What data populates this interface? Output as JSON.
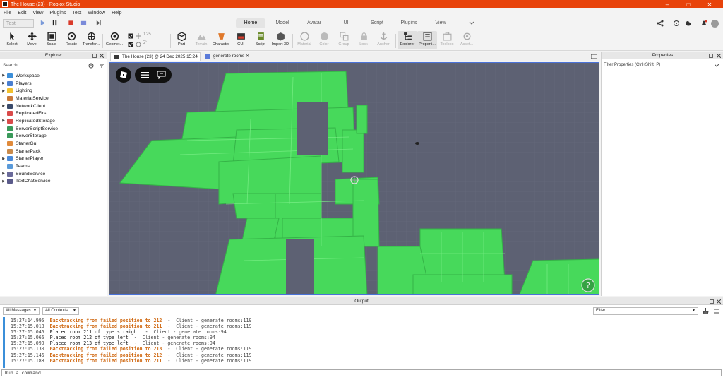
{
  "window": {
    "title": "The House (23) - Roblox Studio"
  },
  "menu": [
    "File",
    "Edit",
    "View",
    "Plugins",
    "Test",
    "Window",
    "Help"
  ],
  "test_selector": "Test",
  "ribbon_tabs": [
    "Home",
    "Model",
    "Avatar",
    "UI",
    "Script",
    "Plugins",
    "View"
  ],
  "active_ribbon_tab": "Home",
  "toolbar": {
    "select": "Select",
    "move": "Move",
    "scale": "Scale",
    "rotate": "Rotate",
    "transform": "Transfor...",
    "geometry": "Geomet...",
    "move_snap": "0.25",
    "rotate_snap": "5°",
    "part": "Part",
    "terrain": "Terrain",
    "character": "Character",
    "gui": "GUI",
    "script": "Script",
    "import3d": "Import 3D",
    "material": "Material",
    "color": "Color",
    "group": "Group",
    "lock": "Lock",
    "anchor": "Anchor",
    "explorer": "Explorer",
    "properties": "Properti...",
    "toolbox": "Toolbox",
    "assets": "Asset..."
  },
  "explorer": {
    "title": "Explorer",
    "search_placeholder": "Search",
    "items": [
      {
        "label": "Workspace",
        "expandable": true,
        "color": "#3d8fd9"
      },
      {
        "label": "Players",
        "expandable": true,
        "color": "#4a7fd0"
      },
      {
        "label": "Lighting",
        "expandable": true,
        "color": "#f2c12e"
      },
      {
        "label": "MaterialService",
        "expandable": false,
        "color": "#c97a3a"
      },
      {
        "label": "NetworkClient",
        "expandable": true,
        "color": "#3a4a6a"
      },
      {
        "label": "ReplicatedFirst",
        "expandable": false,
        "color": "#d94a4a"
      },
      {
        "label": "ReplicatedStorage",
        "expandable": true,
        "color": "#d94a4a"
      },
      {
        "label": "ServerScriptService",
        "expandable": false,
        "color": "#3a9a5a"
      },
      {
        "label": "ServerStorage",
        "expandable": false,
        "color": "#3a9a5a"
      },
      {
        "label": "StarterGui",
        "expandable": false,
        "color": "#e08a3a"
      },
      {
        "label": "StarterPack",
        "expandable": false,
        "color": "#c98a4a"
      },
      {
        "label": "StarterPlayer",
        "expandable": true,
        "color": "#4a8ad9"
      },
      {
        "label": "Teams",
        "expandable": false,
        "color": "#5a9ad9"
      },
      {
        "label": "SoundService",
        "expandable": true,
        "color": "#6a6a9a"
      },
      {
        "label": "TextChatService",
        "expandable": true,
        "color": "#5a5a8a"
      }
    ]
  },
  "doc_tabs": [
    {
      "label": "The House (23) @ 24 Dec 2025 15:24",
      "active": true
    },
    {
      "label": "generate rooms",
      "active": false
    }
  ],
  "properties": {
    "title": "Properties",
    "filter_placeholder": "Filter Properties (Ctrl+Shift+P)"
  },
  "output": {
    "title": "Output",
    "messages_filter": "All Messages",
    "contexts_filter": "All Contexts",
    "filter_placeholder": "Filter...",
    "lines": [
      {
        "time": "15:27:14.995",
        "text": "Backtracking from failed position to 212",
        "source": "Client - generate rooms:119",
        "kind": "warn"
      },
      {
        "time": "15:27:15.018",
        "text": "Backtracking from failed position to 211",
        "source": "Client - generate rooms:119",
        "kind": "warn"
      },
      {
        "time": "15:27:15.046",
        "text": "Placed room 211 of type straight",
        "source": "Client - generate rooms:94",
        "kind": "info"
      },
      {
        "time": "15:27:15.066",
        "text": "Placed room 212 of type left",
        "source": "Client - generate rooms:94",
        "kind": "info"
      },
      {
        "time": "15:27:15.090",
        "text": "Placed room 213 of type left",
        "source": "Client - generate rooms:94",
        "kind": "info"
      },
      {
        "time": "15:27:15.130",
        "text": "Backtracking from failed position to 213",
        "source": "Client - generate rooms:119",
        "kind": "warn"
      },
      {
        "time": "15:27:15.146",
        "text": "Backtracking from failed position to 212",
        "source": "Client - generate rooms:119",
        "kind": "warn"
      },
      {
        "time": "15:27:15.188",
        "text": "Backtracking from failed position to 211",
        "source": "Client - generate rooms:119",
        "kind": "warn"
      }
    ],
    "command_placeholder": "Run a command"
  },
  "colors": {
    "titlebar": "#e8430a",
    "viewport_bg": "#5d6173",
    "room_green": "#46e05a",
    "warn": "#d06a14",
    "selection_border": "#4a72d8"
  }
}
